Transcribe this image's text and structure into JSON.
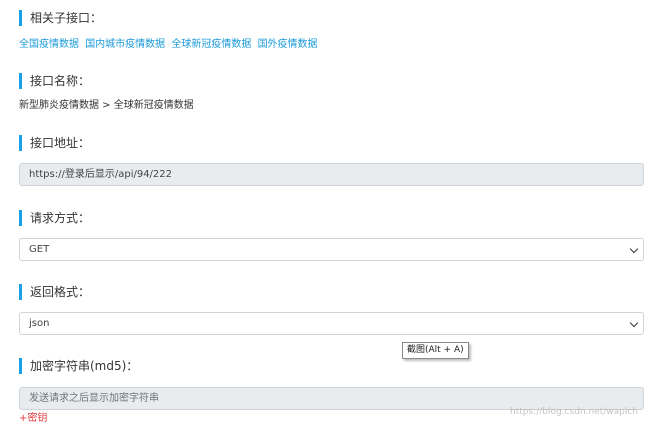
{
  "related": {
    "title": "相关子接口：",
    "links": [
      "全国疫情数据",
      "国内城市疫情数据",
      "全球新冠疫情数据",
      "国外疫情数据"
    ]
  },
  "api_name": {
    "title": "接口名称：",
    "value": "新型肺炎疫情数据 > 全球新冠疫情数据"
  },
  "api_url": {
    "title": "接口地址：",
    "value": "https://登录后显示/api/94/222"
  },
  "method": {
    "title": "请求方式：",
    "selected": "GET"
  },
  "format": {
    "title": "返回格式：",
    "selected": "json"
  },
  "secret": {
    "title": "加密字符串(md5)：",
    "placeholder": "发送请求之后显示加密字符串",
    "add_link": "+密钥"
  },
  "tooltip": "截图(Alt + A)",
  "watermark": "https://blog.csdn.net/waplch"
}
